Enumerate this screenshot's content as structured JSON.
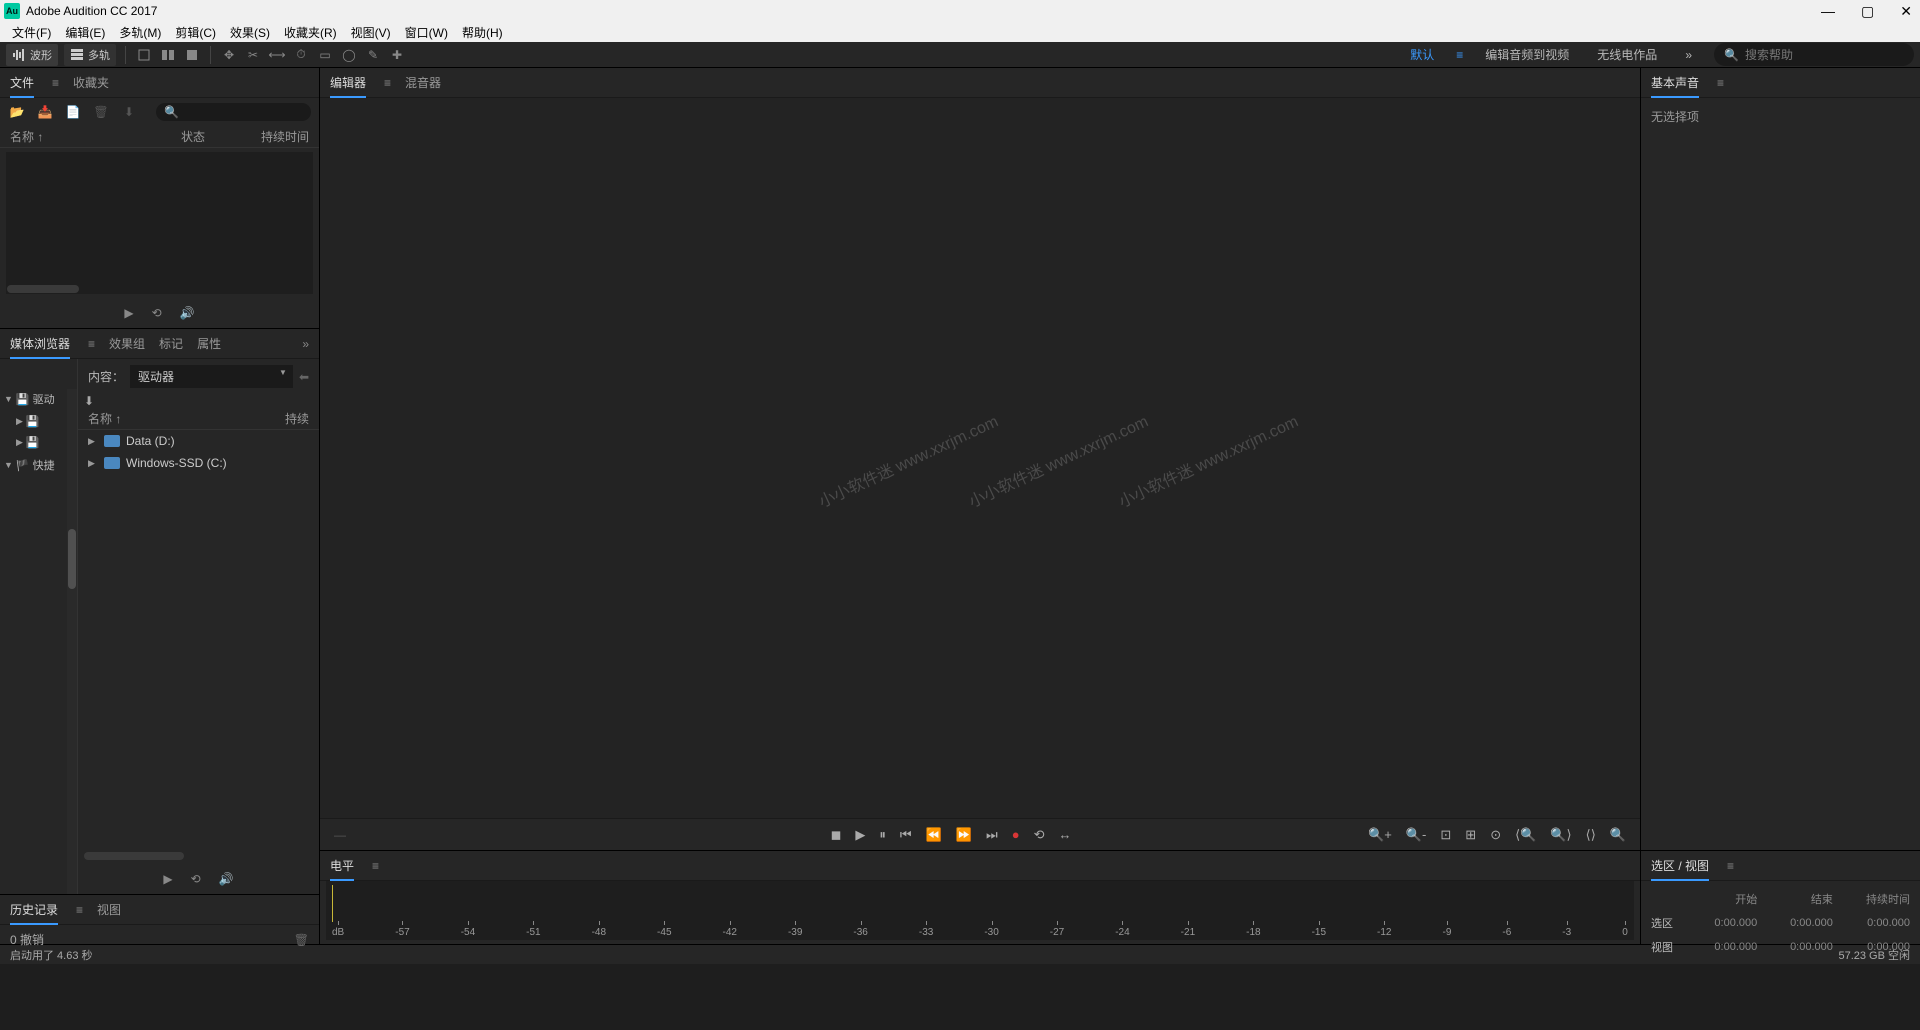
{
  "app": {
    "title": "Adobe Audition CC 2017"
  },
  "menubar": {
    "file": "文件(F)",
    "edit": "编辑(E)",
    "multitrack": "多轨(M)",
    "clip": "剪辑(C)",
    "effects": "效果(S)",
    "favorites": "收藏夹(R)",
    "view": "视图(V)",
    "window": "窗口(W)",
    "help": "帮助(H)"
  },
  "toolbar": {
    "waveform": "波形",
    "multitrack": "多轨",
    "default": "默认",
    "edit_audio": "编辑音频到视频",
    "radio": "无线电作品",
    "search_ph": "搜索帮助"
  },
  "files": {
    "tab": "文件",
    "fav": "收藏夹",
    "col_name": "名称 ↑",
    "col_status": "状态",
    "col_duration": "持续时间"
  },
  "media": {
    "tab": "媒体浏览器",
    "effects": "效果组",
    "markers": "标记",
    "properties": "属性",
    "content_label": "内容：",
    "dropdown": "驱动器",
    "col_name": "名称 ↑",
    "col_dur": "持续",
    "tree_drives": "驱动",
    "tree_shortcuts": "快捷",
    "item_data": "Data (D:)",
    "item_windows": "Windows-SSD (C:)"
  },
  "history": {
    "tab": "历史记录",
    "view": "视图",
    "undo": "0 撤销"
  },
  "editor": {
    "tab": "编辑器",
    "mixer": "混音器",
    "watermark": "小小软件迷 www.xxrjm.com"
  },
  "levels": {
    "tab": "电平",
    "scale": [
      "dB",
      "-57",
      "-54",
      "-51",
      "-48",
      "-45",
      "-42",
      "-39",
      "-36",
      "-33",
      "-30",
      "-27",
      "-24",
      "-21",
      "-18",
      "-15",
      "-12",
      "-9",
      "-6",
      "-3",
      "0"
    ]
  },
  "essential": {
    "tab": "基本声音",
    "noselect": "无选择项"
  },
  "selview": {
    "title": "选区 / 视图",
    "col_start": "开始",
    "col_end": "结束",
    "col_dur": "持续时间",
    "row_sel": "选区",
    "row_view": "视图",
    "zero": "0:00.000"
  },
  "status": {
    "left": "启动用了 4.63 秒",
    "right": "57.23 GB 空闲"
  }
}
